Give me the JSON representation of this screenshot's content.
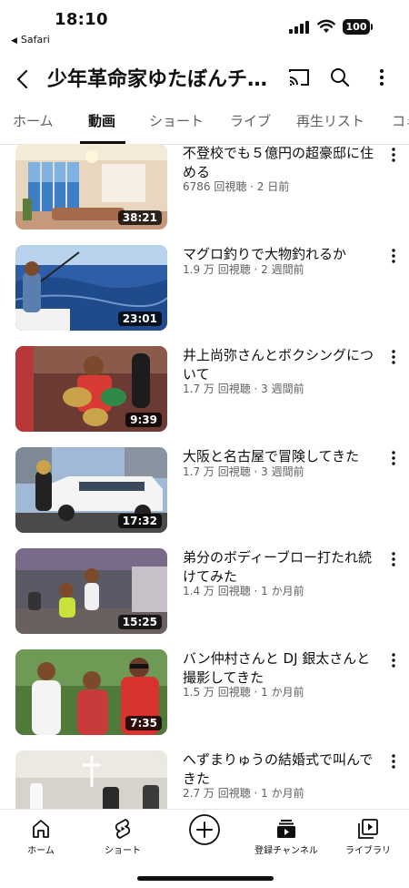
{
  "status_bar": {
    "time": "18:10",
    "back_app": "Safari",
    "battery": "100"
  },
  "header": {
    "channel_title": "少年革命家ゆたぼんチ…",
    "icons": [
      "back-arrow-icon",
      "cast-icon",
      "search-icon",
      "more-vert-icon"
    ]
  },
  "tabs": [
    {
      "label": "ホーム",
      "active": false
    },
    {
      "label": "動画",
      "active": true
    },
    {
      "label": "ショート",
      "active": false
    },
    {
      "label": "ライブ",
      "active": false
    },
    {
      "label": "再生リスト",
      "active": false
    },
    {
      "label": "コミ",
      "active": false
    }
  ],
  "videos": [
    {
      "title": "不登校でも５億円の超豪邸に住める",
      "meta": "6786 回視聴 · 2 日前",
      "duration": "38:21"
    },
    {
      "title": "マグロ釣りで大物釣れるか",
      "meta": "1.9 万 回視聴 · 2 週間前",
      "duration": "23:01"
    },
    {
      "title": "井上尚弥さんとボクシングについて",
      "meta": "1.7 万 回視聴 · 3 週間前",
      "duration": "9:39"
    },
    {
      "title": "大阪と名古屋で冒険してきた",
      "meta": "1.7 万 回視聴 · 3 週間前",
      "duration": "17:32"
    },
    {
      "title": "弟分のボディーブロー打たれ続けてみた",
      "meta": "1.4 万 回視聴 · 1 か月前",
      "duration": "15:25"
    },
    {
      "title": "バン仲村さんと DJ 銀太さんと撮影してきた",
      "meta": "1.5 万 回視聴 · 1 か月前",
      "duration": "7:35"
    },
    {
      "title": "へずまりゅうの結婚式で叫んできた",
      "meta": "2.7 万 回視聴 · 1 か月前",
      "duration": ""
    }
  ],
  "bottom_nav": {
    "home": "ホーム",
    "shorts": "ショート",
    "subscriptions": "登録チャンネル",
    "library": "ライブラリ"
  },
  "colors": {
    "text_primary": "#0f0f0f",
    "text_secondary": "#606060",
    "divider": "#e5e5e5"
  }
}
